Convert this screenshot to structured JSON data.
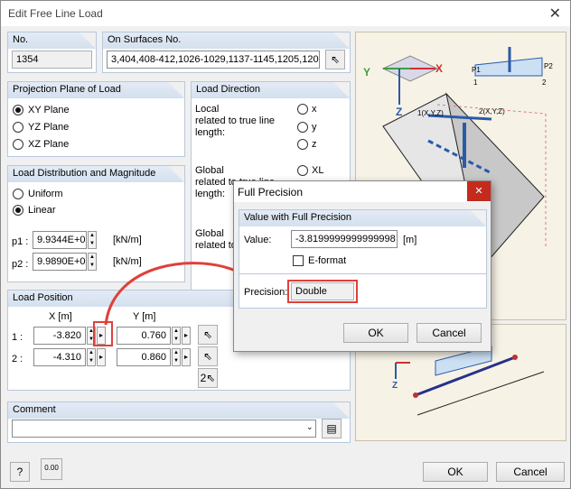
{
  "window": {
    "title": "Edit Free Line Load",
    "close_glyph": "✕"
  },
  "no": {
    "label": "No.",
    "value": "1354"
  },
  "surfaces": {
    "label": "On Surfaces No.",
    "value": "3,404,408-412,1026-1029,1137-1145,1205,1207"
  },
  "projection": {
    "title": "Projection Plane of Load",
    "options": [
      "XY Plane",
      "YZ Plane",
      "XZ Plane"
    ]
  },
  "direction": {
    "title": "Load Direction",
    "local_label": "Local\nrelated to true line\nlength:",
    "local_opts": [
      "x",
      "y",
      "z"
    ],
    "global1_label": "Global\nrelated to true line\nlength:",
    "global1_opts": [
      "XL"
    ],
    "global2_label": "Global\nrelated to true line"
  },
  "distribution": {
    "title": "Load Distribution and Magnitude",
    "options": [
      "Uniform",
      "Linear"
    ],
    "p1_label": "p1 :",
    "p1_value": "9.9344E+0",
    "p1_unit": "[kN/m]",
    "p2_label": "p2 :",
    "p2_value": "9.9890E+0",
    "p2_unit": "[kN/m]"
  },
  "position": {
    "title": "Load Position",
    "x_header": "X  [m]",
    "y_header": "Y  [m]",
    "row1_label": "1 :",
    "row1_x": "-3.820",
    "row1_y": "0.760",
    "row2_label": "2 :",
    "row2_x": "-4.310",
    "row2_y": "0.860"
  },
  "comment": {
    "title": "Comment",
    "value": ""
  },
  "footer": {
    "ok": "OK",
    "cancel": "Cancel",
    "calc": "0.00"
  },
  "diagram": {
    "labels": [
      "Y",
      "X",
      "Z",
      "P1",
      "P2",
      "1",
      "2",
      "1(X,Y,Z)",
      "2(X,Y,Z)",
      "Z"
    ]
  },
  "full_precision": {
    "title": "Full Precision",
    "section": "Value with Full Precision",
    "value_label": "Value:",
    "value": "-3.8199999999999998",
    "unit": "[m]",
    "eformat": "E-format",
    "precision_label": "Precision:",
    "precision_value": "Double",
    "ok": "OK",
    "cancel": "Cancel",
    "close_glyph": "✕"
  },
  "colors": {
    "highlight": "#e0403a",
    "accent": "#2255aa"
  }
}
